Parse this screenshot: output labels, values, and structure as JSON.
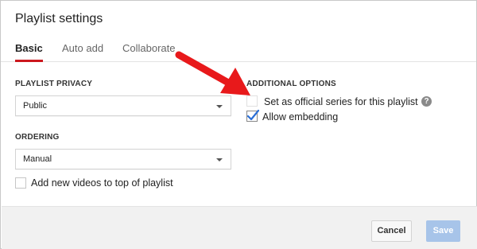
{
  "dialog": {
    "title": "Playlist settings"
  },
  "tabs": [
    {
      "label": "Basic",
      "active": true
    },
    {
      "label": "Auto add",
      "active": false
    },
    {
      "label": "Collaborate",
      "active": false
    }
  ],
  "privacy": {
    "label": "PLAYLIST PRIVACY",
    "selected": "Public"
  },
  "ordering": {
    "label": "ORDERING",
    "selected": "Manual"
  },
  "add_to_top": {
    "label": "Add new videos to top of playlist",
    "checked": false
  },
  "additional": {
    "label": "ADDITIONAL OPTIONS",
    "official_series": {
      "label": "Set as official series for this playlist",
      "checked": false,
      "disabled": true
    },
    "embedding": {
      "label": "Allow embedding",
      "checked": true
    }
  },
  "footer": {
    "cancel_label": "Cancel",
    "save_label": "Save"
  },
  "colors": {
    "accent_red": "#cc181e",
    "save_blue": "#a7c4e9",
    "arrow_red": "#e8191b"
  },
  "icons": {
    "help": "help-circle-icon",
    "checkmark": "checkmark-icon",
    "dropdown": "caret-down-icon",
    "annotation": "red-arrow-icon"
  }
}
